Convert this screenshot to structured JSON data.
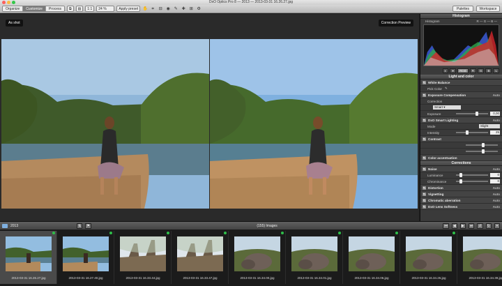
{
  "window": {
    "title": "DxO Optics Pro 8 — 2013 — 2013-03-31 16.26.27.jpg"
  },
  "toolbar": {
    "tabs": [
      {
        "label": "Organize",
        "active": false
      },
      {
        "label": "Customize",
        "active": true
      },
      {
        "label": "Process",
        "active": false
      }
    ],
    "view_mode": "1:1",
    "zoom": "24 %",
    "preset_label": "Apply preset",
    "palettes_label": "Palettes",
    "workspace_label": "Workspace"
  },
  "viewer": {
    "left_label": "As shot",
    "right_label": "Correction Preview"
  },
  "panel": {
    "histogram_title": "Histogram",
    "histogram_sub": "Histogram",
    "channel_readout": "R — G — B —",
    "channels": [
      "RGB",
      "R",
      "G",
      "B",
      "L"
    ],
    "light_color_title": "Light and color",
    "rows": [
      {
        "id": "white-balance",
        "label": "White Balance",
        "type": "section"
      },
      {
        "id": "pick-color",
        "label": "Pick Color",
        "type": "sub"
      },
      {
        "id": "exposure-comp",
        "label": "Exposure Compensation",
        "type": "section",
        "auto": "Auto"
      },
      {
        "id": "correction",
        "label": "Correction",
        "type": "sub"
      },
      {
        "id": "smart",
        "label": "Smart",
        "type": "dropdown"
      },
      {
        "id": "exposure",
        "label": "Exposure",
        "type": "slider",
        "value": "0,00",
        "pos": 0.6
      },
      {
        "id": "smart-lighting",
        "label": "DxO Smart Lighting",
        "type": "section",
        "auto": "Auto"
      },
      {
        "id": "mode",
        "label": "Mode",
        "type": "sub",
        "dropdown": "Slight"
      },
      {
        "id": "intensity",
        "label": "Intensity",
        "type": "slider",
        "value": "25",
        "pos": 0.3
      },
      {
        "id": "contrast",
        "label": "Contrast",
        "type": "section"
      },
      {
        "id": "contrast-s1",
        "label": "",
        "type": "slider",
        "value": "",
        "pos": 0.5
      },
      {
        "id": "contrast-s2",
        "label": "",
        "type": "slider",
        "value": "",
        "pos": 0.5
      },
      {
        "id": "color-accent",
        "label": "Color accentuation",
        "type": "section"
      }
    ],
    "corrections_title": "Corrections",
    "corr_rows": [
      {
        "id": "noise",
        "label": "Noise",
        "type": "section",
        "auto": "Auto"
      },
      {
        "id": "luminance",
        "label": "Luminance",
        "type": "slider",
        "value": "0",
        "pos": 0.1
      },
      {
        "id": "chrominance",
        "label": "Chrominance",
        "type": "slider",
        "value": "0",
        "pos": 0.1
      },
      {
        "id": "distortion",
        "label": "Distortion",
        "type": "section",
        "auto": "Auto"
      },
      {
        "id": "vignetting",
        "label": "Vignetting",
        "type": "section",
        "auto": "Auto"
      },
      {
        "id": "chromatic",
        "label": "Chromatic aberration",
        "type": "section",
        "auto": "Auto"
      },
      {
        "id": "lens-softness",
        "label": "DxO Lens Softness",
        "type": "section",
        "auto": "Auto"
      }
    ]
  },
  "browser": {
    "folder": "2013",
    "count_label": "(155) Images",
    "thumbs": [
      {
        "caption": "2013-03-31 16.26.27.jpg",
        "selected": true,
        "scene": "lake"
      },
      {
        "caption": "2013-03-31 16.27.40.jpg",
        "selected": false,
        "scene": "lake"
      },
      {
        "caption": "2013-03-31 16.33.44.jpg",
        "selected": false,
        "scene": "tree"
      },
      {
        "caption": "2013-03-31 16.33.47.jpg",
        "selected": false,
        "scene": "tree"
      },
      {
        "caption": "2013-03-31 16.34.00.jpg",
        "selected": false,
        "scene": "rocks"
      },
      {
        "caption": "2013-03-31 16.34.01.jpg",
        "selected": false,
        "scene": "rocks"
      },
      {
        "caption": "2013-03-31 16.34.06.jpg",
        "selected": false,
        "scene": "rocks"
      },
      {
        "caption": "2013-03-31 16.34.26.jpg",
        "selected": false,
        "scene": "rocks"
      },
      {
        "caption": "2013-03-31 16.34.39.jpg",
        "selected": false,
        "scene": "rocks"
      }
    ]
  }
}
